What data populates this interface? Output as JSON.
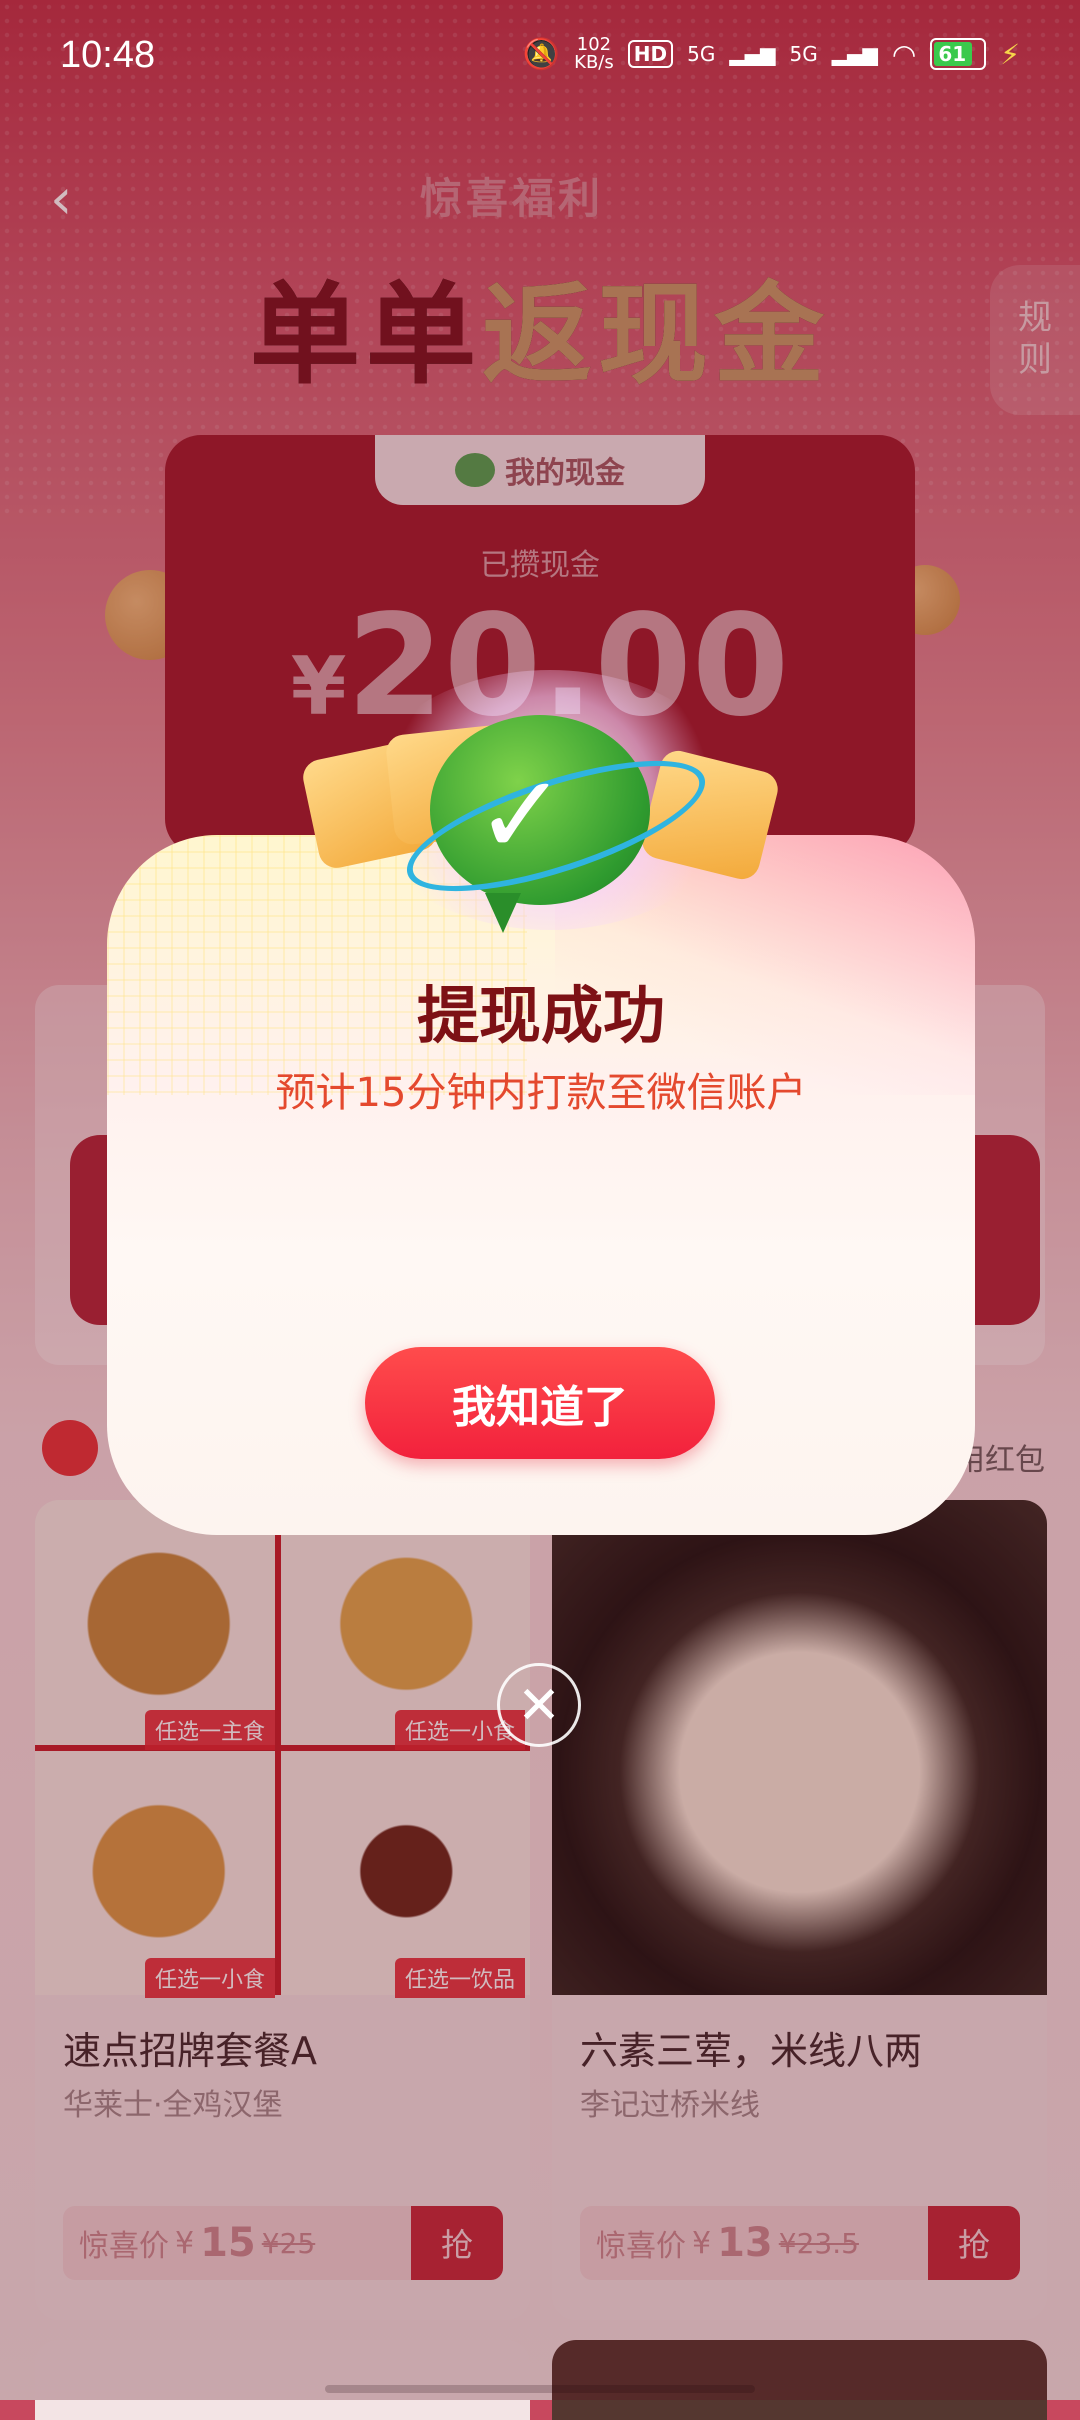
{
  "status_bar": {
    "time": "10:48",
    "network_speed": "102\nKB/s",
    "hd_label": "HD",
    "signal_1": "5G",
    "signal_2": "5G",
    "battery": "61"
  },
  "header": {
    "brand_sub": "惊喜福利",
    "brand_title_part1": "单单",
    "brand_title_part2": "返现金",
    "rules_label": "规\n则"
  },
  "cash_card": {
    "tab_label": "我的现金",
    "amount_label": "已攒现金",
    "currency": "¥",
    "amount": "20.00"
  },
  "section": {
    "hongbao_text": "用红包"
  },
  "products": [
    {
      "title": "速点招牌套餐A",
      "shop": "华莱士·全鸡汉堡",
      "price_label": "惊喜价",
      "currency": "¥",
      "price": "15",
      "old_price": "¥25",
      "grab": "抢",
      "tags": [
        "任选一主食",
        "任选一小食",
        "任选一小食",
        "任选一饮品"
      ]
    },
    {
      "title": "六素三荤，米线八两",
      "shop": "李记过桥米线",
      "price_label": "惊喜价",
      "currency": "¥",
      "price": "13",
      "old_price": "¥23.5",
      "grab": "抢"
    }
  ],
  "modal": {
    "title": "提现成功",
    "subtitle": "预计15分钟内打款至微信账户",
    "ok_button": "我知道了",
    "close_symbol": "✕"
  },
  "colors": {
    "modal_title": "#7d1115",
    "modal_subtitle": "#e4492e",
    "button_red": "#f2213c",
    "wechat_green": "#2f9b2f"
  }
}
